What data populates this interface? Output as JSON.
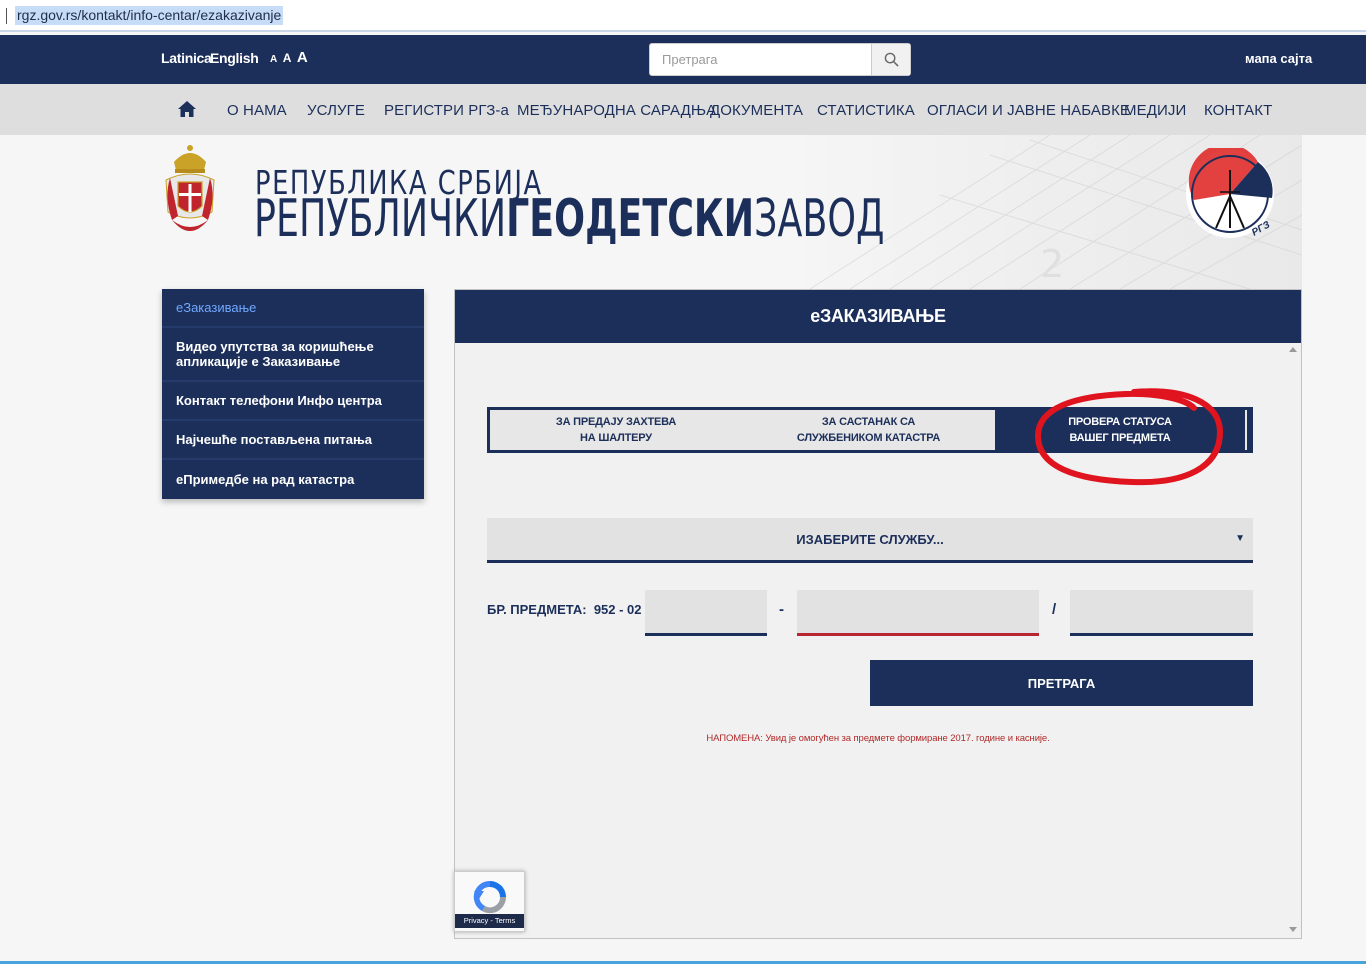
{
  "browser": {
    "url": "rgz.gov.rs/kontakt/info-centar/ezakazivanje"
  },
  "topbar": {
    "lang_latin": "Latinica",
    "lang_english": "English",
    "font_small": "A",
    "font_medium": "A",
    "font_large": "A",
    "search_placeholder": "Претрага",
    "sitemap": "мапа сајта"
  },
  "nav": {
    "items": [
      "О НАМА",
      "УСЛУГЕ",
      "РЕГИСТРИ РГЗ-а",
      "МЕЂУНАРОДНА САРАДЊА",
      "ДОКУМЕНТА",
      "СТАТИСТИКА",
      "ОГЛАСИ И ЈАВНЕ НАБАВКЕ",
      "МЕДИЈИ",
      "КОНТАКТ"
    ]
  },
  "header": {
    "line1": "РЕПУБЛИКА СРБИЈА",
    "line2_a": "РЕПУБЛИЧКИ",
    "line2_b": "ГЕОДЕТСКИ",
    "line2_c": "ЗАВОД",
    "logo_text": "РГЗ"
  },
  "sidebar": {
    "items": [
      {
        "label": "еЗаказивање",
        "active": true
      },
      {
        "label": "Видео упутства за коришћење апликације е Заказивање",
        "active": false
      },
      {
        "label": "Контакт телефони Инфо центра",
        "active": false
      },
      {
        "label": "Најчешће постављена питања",
        "active": false
      },
      {
        "label": "еПримедбе на рад катастра",
        "active": false
      }
    ]
  },
  "panel": {
    "title": "еЗАКАЗИВАЊЕ",
    "tabs": [
      {
        "line1": "ЗА ПРЕДАЈУ ЗАХТЕВА",
        "line2": "НА ШАЛТЕРУ"
      },
      {
        "line1": "ЗА САСТАНАК СА",
        "line2": "СЛУЖБЕНИКОМ КАТАСТРА"
      },
      {
        "line1": "ПРОВЕРА СТАТУСА",
        "line2": "ВАШЕГ ПРЕДМЕТА"
      }
    ],
    "select_label": "ИЗАБЕРИТЕ СЛУЖБУ...",
    "case_label": "БР. ПРЕДМЕТА:",
    "case_prefix": "952 - 02 -",
    "sep_dash": "-",
    "sep_slash": "/",
    "submit": "ПРЕТРАГА",
    "note": "НАПОМЕНА: Увид је омогућен за предмете формиране 2017. године и касније."
  },
  "recaptcha": {
    "text": "Privacy - Terms"
  },
  "colors": {
    "primary": "#1c2f5a",
    "nav_bg": "#dedede",
    "annotation": "#e0141e",
    "error": "#b8262f"
  }
}
